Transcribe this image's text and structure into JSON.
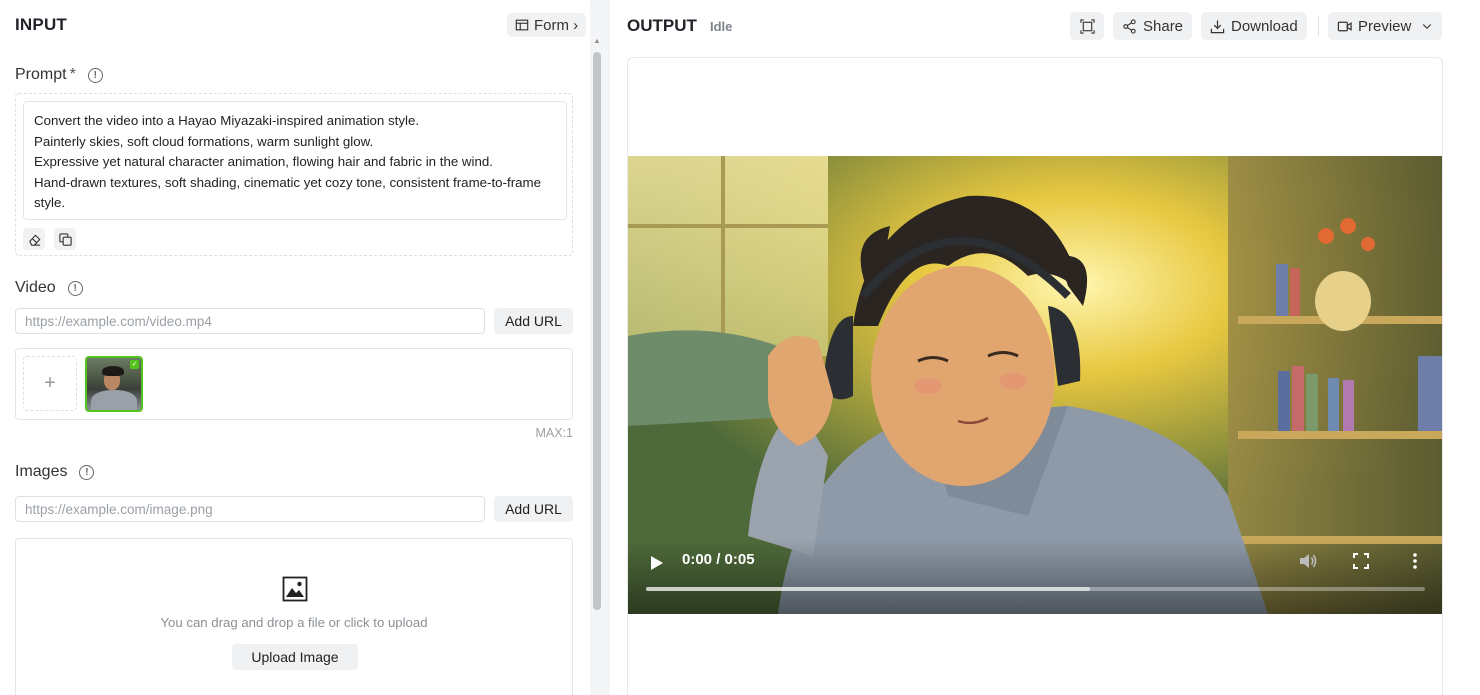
{
  "input": {
    "title": "INPUT",
    "form_label": "Form ›",
    "prompt": {
      "label": "Prompt",
      "required_mark": "*",
      "text": "Convert the video into a Hayao Miyazaki-inspired animation style.\nPainterly skies, soft cloud formations, warm sunlight glow.\nExpressive yet natural character animation, flowing hair and fabric in the wind.\nHand-drawn textures, soft shading, cinematic yet cozy tone, consistent frame-to-frame style."
    },
    "video": {
      "label": "Video",
      "url_placeholder": "https://example.com/video.mp4",
      "add_url_label": "Add URL",
      "add_slot": "+",
      "max_note": "MAX:1"
    },
    "images": {
      "label": "Images",
      "url_placeholder": "https://example.com/image.png",
      "add_url_label": "Add URL",
      "upload_hint": "You can drag and drop a file or click to upload",
      "upload_button": "Upload Image"
    }
  },
  "output": {
    "title": "OUTPUT",
    "status": "Idle",
    "share_label": "Share",
    "download_label": "Download",
    "preview_label": "Preview",
    "player": {
      "time": "0:00 / 0:05",
      "buffered_fraction": 0.57
    }
  },
  "colors": {
    "accent_green": "#52c41a",
    "button_bg": "#f0f1f3",
    "border": "#e3e5e8"
  },
  "icons": [
    "table-icon",
    "info-icon",
    "eraser-icon",
    "copy-icon",
    "image-icon",
    "expand-icon",
    "share-icon",
    "download-icon",
    "video-camera-icon",
    "chevron-down-icon",
    "play-icon",
    "volume-icon",
    "fullscreen-icon",
    "more-vertical-icon"
  ]
}
